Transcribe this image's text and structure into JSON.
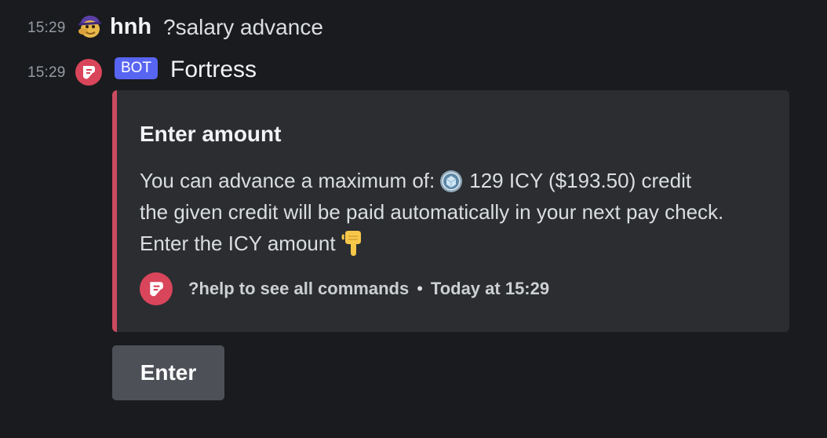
{
  "messages": [
    {
      "timestamp": "15:29",
      "author": "hnh",
      "content": "?salary advance",
      "avatar_icon": "duck-avatar-icon"
    },
    {
      "timestamp": "15:29",
      "author": "Fortress",
      "badge": "BOT",
      "avatar_icon": "fortress-logo-icon"
    }
  ],
  "embed": {
    "title": "Enter amount",
    "line1_prefix": "You can advance a maximum of:",
    "line1_suffix": "129 ICY ($193.50) credit",
    "line2": "the given credit will be paid automatically in your next pay check.",
    "line3": "Enter the ICY amount",
    "coin_icon": "icy-coin-icon",
    "pointer_icon": "pointing-down-hand-icon",
    "footer_text": "?help to see all commands",
    "footer_separator": "•",
    "footer_time": "Today at 15:29",
    "accent_color": "#c94b5f"
  },
  "button": {
    "label": "Enter"
  },
  "colors": {
    "background": "#1a1b1e",
    "embed_background": "#2b2d31",
    "bot_badge": "#5865f2",
    "button": "#4e5058"
  }
}
